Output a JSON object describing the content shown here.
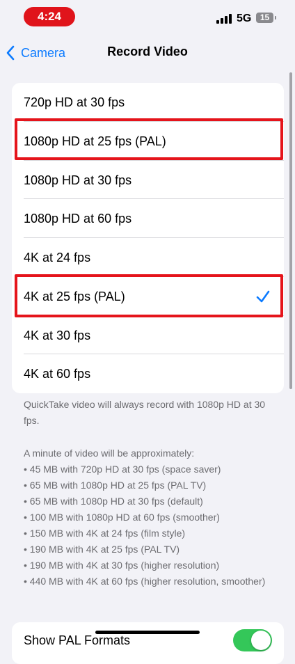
{
  "status_bar": {
    "time": "4:24",
    "network": "5G",
    "battery": "15"
  },
  "nav": {
    "back_label": "Camera",
    "title": "Record Video"
  },
  "formats": [
    {
      "label": "720p HD at 30 fps",
      "selected": false
    },
    {
      "label": "1080p HD at 25 fps (PAL)",
      "selected": false
    },
    {
      "label": "1080p HD at 30 fps",
      "selected": false
    },
    {
      "label": "1080p HD at 60 fps",
      "selected": false
    },
    {
      "label": "4K at 24 fps",
      "selected": false
    },
    {
      "label": "4K at 25 fps (PAL)",
      "selected": true
    },
    {
      "label": "4K at 30 fps",
      "selected": false
    },
    {
      "label": "4K at 60 fps",
      "selected": false
    }
  ],
  "footer": {
    "quicktake": "QuickTake video will always record with 1080p HD at 30 fps.",
    "intro": "A minute of video will be approximately:",
    "sizes": [
      "• 45 MB with 720p HD at 30 fps (space saver)",
      "• 65 MB with 1080p HD at 25 fps (PAL TV)",
      "• 65 MB with 1080p HD at 30 fps (default)",
      "• 100 MB with 1080p HD at 60 fps (smoother)",
      "• 150 MB with 4K at 24 fps (film style)",
      "• 190 MB with 4K at 25 fps (PAL TV)",
      "• 190 MB with 4K at 30 fps (higher resolution)",
      "• 440 MB with 4K at 60 fps (higher resolution, smoother)"
    ]
  },
  "pal_setting": {
    "label": "Show PAL Formats",
    "enabled": true
  },
  "colors": {
    "accent": "#0a7aff",
    "highlight": "#e5141b",
    "toggle_on": "#34c759"
  }
}
